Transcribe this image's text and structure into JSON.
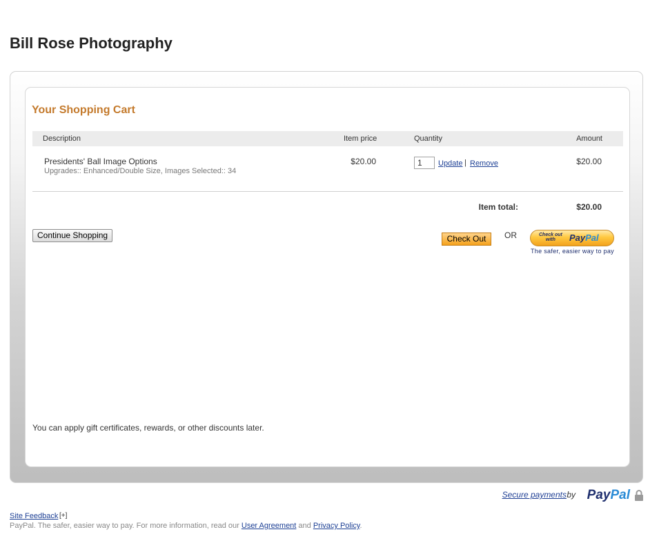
{
  "store": {
    "title": "Bill Rose Photography"
  },
  "cart": {
    "heading": "Your Shopping Cart",
    "columns": {
      "description": "Description",
      "item_price": "Item price",
      "quantity": "Quantity",
      "amount": "Amount"
    },
    "items": [
      {
        "name": "Presidents' Ball Image Options",
        "options": "Upgrades:: Enhanced/Double Size, Images Selected:: 34",
        "price": "$20.00",
        "quantity": "1",
        "update_label": "Update",
        "separator": "|",
        "remove_label": "Remove",
        "amount": "$20.00"
      }
    ],
    "total_label": "Item total:",
    "total_value": "$20.00",
    "continue_label": "Continue Shopping",
    "checkout_label": "Check Out",
    "or_label": "OR",
    "paypal_button": {
      "small_text_line1": "Check out",
      "small_text_line2": "with",
      "brand_part1": "Pay",
      "brand_part2": "Pal",
      "tagline": "The safer, easier way to pay"
    },
    "discount_note": "You can apply gift certificates, rewards, or other discounts later."
  },
  "footer": {
    "secure_payments_label": "Secure payments",
    "by_label": "by",
    "brand_part1": "Pay",
    "brand_part2": "Pal",
    "site_feedback_label": "Site Feedback",
    "feedback_plus": "[+]",
    "info_text": "PayPal. The safer, easier way to pay. For more information, read our",
    "user_agreement_label": "User Agreement",
    "and_label": "and",
    "privacy_policy_label": "Privacy Policy",
    "info_end": "."
  },
  "icons": {
    "lock": "lock-icon"
  },
  "colors": {
    "heading_accent": "#c47a2c",
    "link": "#1c3f94",
    "paypal_dark": "#1f2f6e",
    "paypal_light": "#2a8bd6",
    "checkout_button": "#f5a21c"
  }
}
